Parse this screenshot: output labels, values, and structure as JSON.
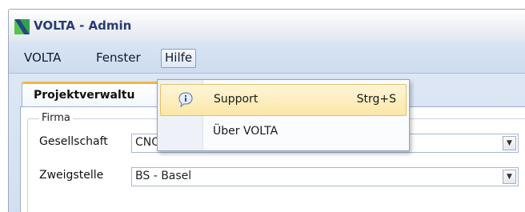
{
  "window": {
    "title": "VOLTA - Admin",
    "logo_icon": "volta-logo-icon"
  },
  "menubar": {
    "items": [
      {
        "label": "VOLTA"
      },
      {
        "label": "Fenster"
      },
      {
        "label": "Hilfe"
      }
    ]
  },
  "tabs": [
    {
      "label": "Projektverwaltu",
      "active": true
    }
  ],
  "firma": {
    "legend": "Firma",
    "fields": [
      {
        "label": "Gesellschaft",
        "value": "CNO - Karakun AG"
      },
      {
        "label": "Zweigstelle",
        "value": "BS - Basel"
      }
    ]
  },
  "help_menu": {
    "items": [
      {
        "label": "Support",
        "shortcut": "Strg+S",
        "icon": "info-icon",
        "highlighted": true
      },
      {
        "label": "Über VOLTA",
        "shortcut": "",
        "icon": "",
        "highlighted": false
      }
    ]
  },
  "colors": {
    "title_text": "#273c74",
    "menubar": "#d3e0f1",
    "tab_accent": "#f2b640",
    "highlight": "#fbe7a6"
  }
}
